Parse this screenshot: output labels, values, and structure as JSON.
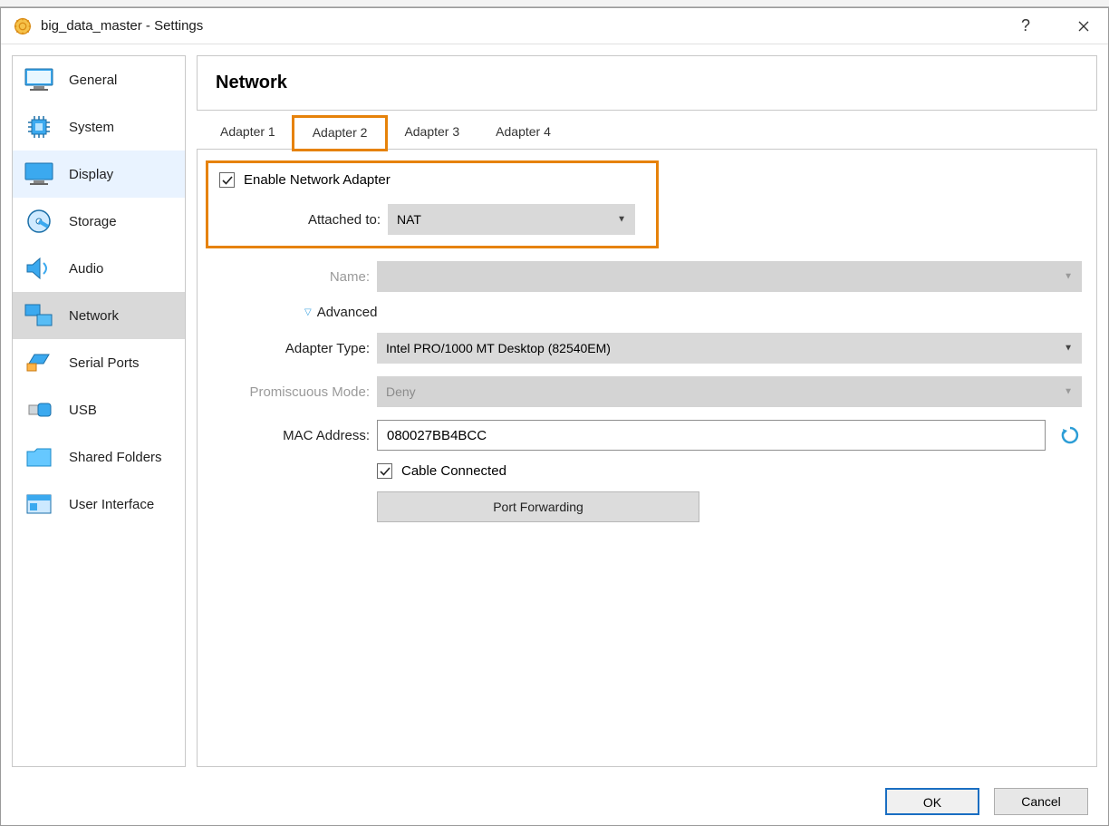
{
  "window": {
    "title": "big_data_master - Settings",
    "help": "?"
  },
  "sidebar": {
    "items": [
      {
        "label": "General"
      },
      {
        "label": "System"
      },
      {
        "label": "Display"
      },
      {
        "label": "Storage"
      },
      {
        "label": "Audio"
      },
      {
        "label": "Network"
      },
      {
        "label": "Serial Ports"
      },
      {
        "label": "USB"
      },
      {
        "label": "Shared Folders"
      },
      {
        "label": "User Interface"
      }
    ]
  },
  "main": {
    "heading": "Network",
    "tabs": [
      {
        "label": "Adapter 1"
      },
      {
        "label": "Adapter 2"
      },
      {
        "label": "Adapter 3"
      },
      {
        "label": "Adapter 4"
      }
    ],
    "enable_label": "Enable Network Adapter",
    "attached_to_label": "Attached to:",
    "attached_to_value": "NAT",
    "name_label": "Name:",
    "name_value": "",
    "advanced_label": "Advanced",
    "adapter_type_label": "Adapter Type:",
    "adapter_type_value": "Intel PRO/1000 MT Desktop (82540EM)",
    "promiscuous_label": "Promiscuous Mode:",
    "promiscuous_value": "Deny",
    "mac_label": "MAC Address:",
    "mac_value": "080027BB4BCC",
    "cable_label": "Cable Connected",
    "port_forwarding_label": "Port Forwarding"
  },
  "footer": {
    "ok": "OK",
    "cancel": "Cancel"
  }
}
